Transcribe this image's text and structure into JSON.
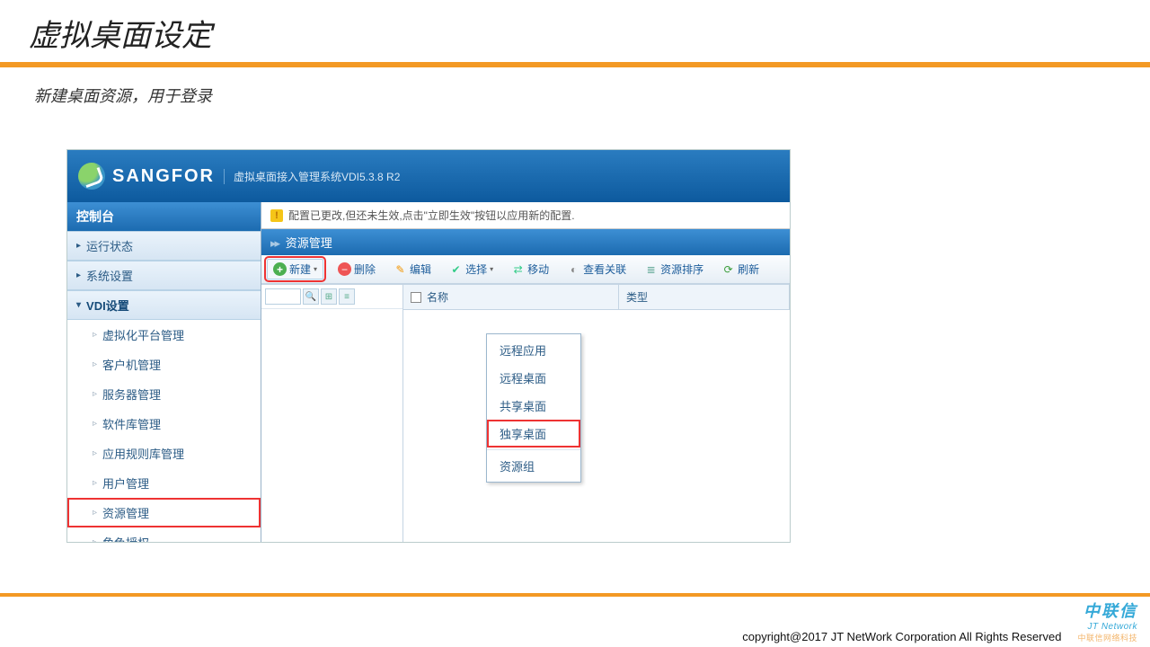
{
  "slide": {
    "title": "虚拟桌面设定",
    "subtitle": "新建桌面资源，用于登录"
  },
  "app": {
    "brand": "SANGFOR",
    "subtitle": "虚拟桌面接入管理系统VDI5.3.8 R2",
    "sidebar_title": "控制台",
    "sections": [
      {
        "label": "运行状态",
        "expanded": false
      },
      {
        "label": "系统设置",
        "expanded": false
      },
      {
        "label": "VDI设置",
        "expanded": true
      }
    ],
    "vdi_items": [
      {
        "label": "虚拟化平台管理"
      },
      {
        "label": "客户机管理"
      },
      {
        "label": "服务器管理"
      },
      {
        "label": "软件库管理"
      },
      {
        "label": "应用规则库管理"
      },
      {
        "label": "用户管理"
      },
      {
        "label": "资源管理",
        "highlight": true
      },
      {
        "label": "角色授权"
      }
    ],
    "warning": "配置已更改,但还未生效,点击\"立即生效\"按钮以应用新的配置.",
    "breadcrumb": "资源管理",
    "toolbar": {
      "new": "新建",
      "delete": "删除",
      "edit": "编辑",
      "select": "选择",
      "move": "移动",
      "viewrel": "查看关联",
      "sort": "资源排序",
      "refresh": "刷新"
    },
    "new_menu": [
      {
        "label": "远程应用"
      },
      {
        "label": "远程桌面"
      },
      {
        "label": "共享桌面"
      },
      {
        "label": "独享桌面",
        "highlight": true
      },
      {
        "sep": true
      },
      {
        "label": "资源组"
      }
    ],
    "grid": {
      "col_name": "名称",
      "col_type": "类型"
    }
  },
  "footer": {
    "copyright": "copyright@2017  JT NetWork Corporation All Rights Reserved",
    "logo_cn": "中联信",
    "logo_en": "JT Network",
    "watermark": "中联信网络科技"
  }
}
